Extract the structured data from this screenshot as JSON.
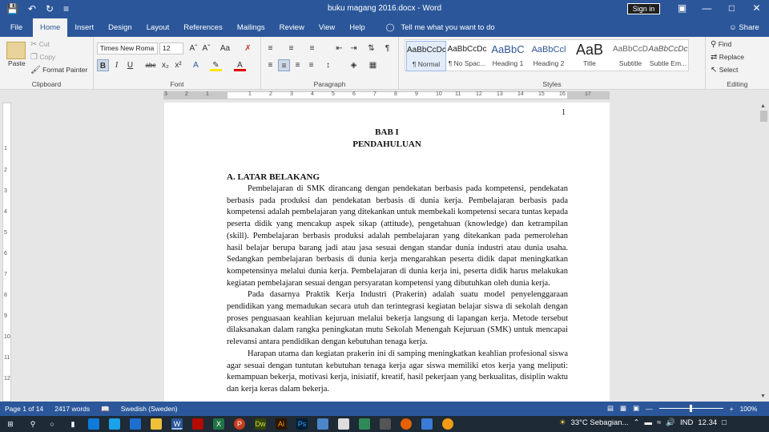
{
  "titlebar": {
    "document_title": "buku magang 2016.docx  -  Word",
    "signin_label": "Sign in",
    "qat_icons": [
      "save-icon",
      "undo-icon",
      "redo-icon",
      "customize-icon"
    ],
    "window_icons": [
      "ribbon-display-icon",
      "minimize-icon",
      "maximize-icon",
      "close-icon"
    ]
  },
  "tabs": {
    "file": "File",
    "items": [
      "Home",
      "Insert",
      "Design",
      "Layout",
      "References",
      "Mailings",
      "Review",
      "View",
      "Help"
    ],
    "active": "Home",
    "tell_me": "Tell me what you want to do",
    "share": "Share"
  },
  "ribbon": {
    "clipboard": {
      "label": "Clipboard",
      "paste": "Paste",
      "cut": "Cut",
      "copy": "Copy",
      "format_painter": "Format Painter"
    },
    "font": {
      "label": "Font",
      "font_name": "Times New Roma",
      "font_size": "12",
      "bold": "B",
      "italic": "I",
      "underline": "U",
      "strike": "abc",
      "sub": "x₂",
      "sup": "x²"
    },
    "paragraph": {
      "label": "Paragraph"
    },
    "styles": {
      "label": "Styles",
      "items": [
        {
          "preview": "AaBbCcDc",
          "name": "¶ Normal"
        },
        {
          "preview": "AaBbCcDc",
          "name": "¶ No Spac..."
        },
        {
          "preview": "AaBbC",
          "name": "Heading 1"
        },
        {
          "preview": "AaBbCcl",
          "name": "Heading 2"
        },
        {
          "preview": "AaB",
          "name": "Title"
        },
        {
          "preview": "AaBbCcD",
          "name": "Subtitle"
        },
        {
          "preview": "AaBbCcDc",
          "name": "Subtle Em..."
        }
      ]
    },
    "editing": {
      "label": "Editing",
      "find": "Find",
      "replace": "Replace",
      "select": "Select"
    }
  },
  "ruler": {
    "numbers": [
      "3",
      "2",
      "1",
      "1",
      "2",
      "3",
      "4",
      "5",
      "6",
      "7",
      "8",
      "9",
      "10",
      "11",
      "12",
      "13",
      "14",
      "15",
      "16",
      "17"
    ]
  },
  "vruler": {
    "numbers": [
      "1",
      "2",
      "3",
      "4",
      "5",
      "6",
      "7",
      "8",
      "9",
      "10",
      "11",
      "12"
    ]
  },
  "document": {
    "page_number": "1",
    "heading1": "BAB I",
    "heading2": "PENDAHULUAN",
    "section": "A.   LATAR  BELAKANG",
    "paragraphs": [
      "Pembelajaran di SMK dirancang dengan pendekatan berbasis pada kompetensi, pendekatan berbasis pada produksi dan pendekatan berbasis di dunia kerja. Pembelajaran berbasis pada kompetensi adalah pembelajaran yang ditekankan untuk membekali kompetensi secara tuntas kepada peserta didik yang mencakup aspek sikap (attitude), pengetahuan (knowledge) dan ketrampilan (skill). Pembelajaran berbasis produksi adalah pembelajaran yang ditekankan pada pemerolehan hasil belajar berupa barang jadi atau jasa sesuai dengan standar dunia industri atau dunia usaha. Sedangkan pembelajaran berbasis di dunia kerja mengarahkan peserta didik dapat meningkatkan kompetensinya melalui dunia kerja. Pembelajaran di dunia kerja ini, peserta didik harus melakukan kegiatan pembelajaran sesuai dengan persyaratan kompetensi yang dibutuhkan oleh dunia kerja.",
      "Pada dasarnya Praktik Kerja Industri (Prakerin) adalah suatu model penyelenggaraan pendidikan yang memadukan secara utuh dan terintegrasi kegiatan belajar siswa di sekolah dengan proses penguasaan keahlian kejuruan melalui bekerja langsung di lapangan kerja. Metode tersebut dilaksanakan dalam rangka peningkatan mutu Sekolah Menengah Kejuruan (SMK) untuk mencapai relevansi antara pendidikan dengan kebutuhan tenaga kerja.",
      "Harapan utama dan kegiatan prakerin ini di samping meningkatkan keahlian profesional siswa agar sesuai dengan tuntutan kebutuhan tenaga kerja agar siswa memiliki etos kerja yang meliputi: kemampuan bekerja, motivasi kerja, inisiatif, kreatif, hasil pekerjaan yang berkualitas, disiplin waktu dan kerja keras dalam bekerja."
    ]
  },
  "status": {
    "page": "Page 1 of 14",
    "words": "2417 words",
    "language": "Swedish (Sweden)",
    "zoom": "100%"
  },
  "taskbar": {
    "weather": "33°C  Sebagian...",
    "lang": "IND",
    "time": "12.34"
  }
}
